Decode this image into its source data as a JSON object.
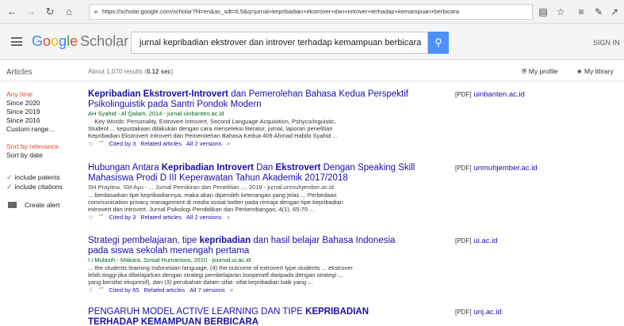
{
  "browser": {
    "url": "https://scholar.google.com/scholar?hl=en&as_sdt=0,5&q=jurnal+kepribadian+ekstrover+dan+introver+terhadap+kemampuan+berbicara",
    "icons": [
      "back-icon",
      "forward-icon",
      "reload-icon",
      "home-icon",
      "lock-icon",
      "reader-icon",
      "star-icon",
      "favorites-icon",
      "pen-icon",
      "share-icon"
    ]
  },
  "header": {
    "logo_google": [
      "G",
      "o",
      "o",
      "g",
      "l",
      "e"
    ],
    "logo_scholar": "Scholar",
    "query": "jurnal kepribadian ekstrover dan introver terhadap kemampuan berbicara",
    "sign_in": "SIGN IN"
  },
  "subheader": {
    "articles": "Articles",
    "count_prefix": "About 1,070 results (",
    "count_time": "0.12 sec",
    "count_suffix": ")",
    "my_profile": "My profile",
    "my_library": "My library"
  },
  "sidebar": {
    "time": [
      "Any time",
      "Since 2020",
      "Since 2019",
      "Since 2016",
      "Custom range..."
    ],
    "sort": [
      "Sort by relevance",
      "Sort by date"
    ],
    "include_patents": "include patents",
    "include_citations": "include citations",
    "create_alert": "Create alert"
  },
  "results": [
    {
      "title_line1_a": "Kepribadian Ekstrovert-Introvert",
      "title_line1_b": " dan Pemerolehan Bahasa Kedua Perspektif",
      "title_line2": "Psikolinguistik pada Santri Pondok Modern",
      "meta": "AH Syahid - Al Qalam, 2014 - jurnal.uinbanten.ac.id",
      "snippet1": "Key Words: Personality, Extrovert-Introvert, Second Language Acquisition, Pshyco/inguistic,",
      "snippet2": "Student ... kepustakaan dilakukan dengan cara menseleksi literatur, jurnal, laporan penelitian",
      "snippet3": "Kepribadian Ekstrovert Introvert dan Pemerolehan Bahasa Kedua 409 Ahmad Habibi Syahid ...",
      "cited": "Cited by 3",
      "related": "Related articles",
      "versions": "All 2 versions",
      "side_tag": "[PDF]",
      "side_domain": "uinbanten.ac.id"
    },
    {
      "title_line1_a": "Hubungan Antara ",
      "title_line1_b": "Kepribadian Introvert",
      "title_line1_c": " Dan ",
      "title_line1_d": "Ekstrovert",
      "title_line1_e": " Dengan Speaking Skill",
      "title_line2": "Mahasiswa Prodi D III Keperawatan Tahun Akademik 2017/2018",
      "meta": "SH Prayitno, SM Ayu - ... Jurnal Pemikiran dan Penelitian ..., 2018 - jurnal.unmuhjember.ac.id",
      "snippet1": "... berdasarkan tipe kepribadiannya, maka akan diperoleh keterangan yang jelas ... Perbedaan",
      "snippet2": "communication privacy management di media sosial twitter pada remaja dengan tipe kepribadian",
      "snippet3": "extrovert dan introvert. Jurnal Psikologi Pendidikan dan Perkembangan, 4(1), 65-70 ...",
      "cited": "Cited by 3",
      "related": "Related articles",
      "versions": "All 2 versions",
      "side_tag": "[PDF]",
      "side_domain": "unmuhjember.ac.id"
    },
    {
      "title_line1_a": "Strategi pembelajaran, tipe ",
      "title_line1_b": "kepribadian",
      "title_line1_c": " dan hasil belajar Bahasa Indonesia",
      "title_line2": "pada siswa sekolah menengah pertama",
      "meta": "I I Mulasih - Makara, Sosial Humaniora, 2010 - journal.ui.ac.id",
      "snippet1": "... the students learning Indonesian language, (4) the outcome of extrovert type students ... ekstrover",
      "snippet2": "lebih tinggi jika dibelajarkan dengan strategi pembelajaran kooperatif daripada dengan strategi ...",
      "snippet3": "yang bersifat ekspresif), dan (3) perubahan dalam sifat- sifat kepribadian baik yang ...",
      "cited": "Cited by 65",
      "related": "Related articles",
      "versions": "All 7 versions",
      "side_tag": "[PDF]",
      "side_domain": "ui.ac.id"
    },
    {
      "title_line1_a": "PENGARUH MODEL ACTIVE LEARNING DAN TIPE ",
      "title_line1_b": "KEPRIBADIAN",
      "title_line2": "TERHADAP KEMAMPUAN BERBICARA",
      "side_tag": "[PDF]",
      "side_domain": "unj.ac.id"
    }
  ],
  "colors": {
    "link": "#1a0dab",
    "meta_green": "#006621",
    "active_red": "#dd4b39",
    "search_blue": "#4d90fe"
  }
}
